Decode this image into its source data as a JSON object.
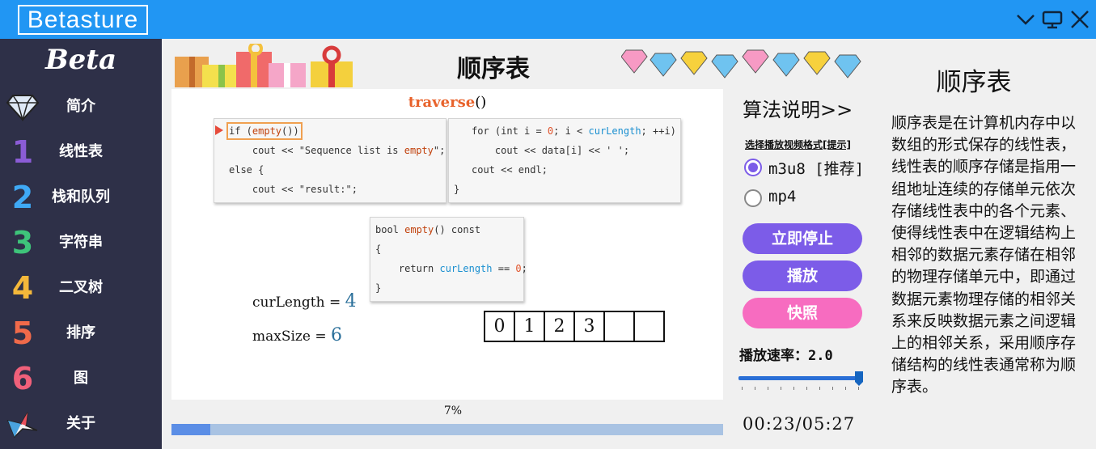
{
  "app": {
    "logo": "Betasture"
  },
  "window_controls": [
    "chevron-down-icon",
    "monitor-icon",
    "close-icon"
  ],
  "sidebar": {
    "brand": "Beta",
    "items": [
      {
        "icon": "diamond-icon",
        "label": "简介"
      },
      {
        "icon": "number-1-icon",
        "label": "线性表"
      },
      {
        "icon": "number-2-icon",
        "label": "栈和队列"
      },
      {
        "icon": "number-3-icon",
        "label": "字符串"
      },
      {
        "icon": "number-4-icon",
        "label": "二叉树"
      },
      {
        "icon": "number-5-icon",
        "label": "排序"
      },
      {
        "icon": "number-6-icon",
        "label": "图"
      },
      {
        "icon": "origami-bird-icon",
        "label": "关于"
      }
    ]
  },
  "header": {
    "title": "顺序表",
    "left_art": "gift-boxes-illustration",
    "right_art": "diamonds-illustration"
  },
  "visual": {
    "function_name": "traverse",
    "function_parens": "()",
    "code_blocks": {
      "main_left": [
        "if (empty())",
        "    cout << \"Sequence list is empty\";",
        "else {",
        "    cout << \"result:\";"
      ],
      "main_right": [
        "for (int i = 0; i < curLength; ++i)",
        "    cout << data[i] << ' ';",
        "cout << endl;",
        "}"
      ],
      "empty_fn": [
        "bool empty() const",
        "{",
        "    return curLength == 0;",
        "}"
      ]
    },
    "variables": [
      {
        "name": "curLength = ",
        "value": "4"
      },
      {
        "name": "maxSize = ",
        "value": "6"
      }
    ],
    "array_cells": [
      "0",
      "1",
      "2",
      "3",
      "",
      ""
    ]
  },
  "progress": {
    "label": "7%",
    "value": 0.07
  },
  "controls": {
    "algo_title": "算法说明>>",
    "format_caption": "选择播放视频格式[提示]",
    "format_options": [
      {
        "label": "m3u8 [推荐]",
        "selected": true
      },
      {
        "label": "mp4",
        "selected": false
      }
    ],
    "buttons": {
      "stop": "立即停止",
      "play": "播放",
      "snapshot": "快照"
    },
    "speed_label": "播放速率：2.0",
    "speed_value": 1.0,
    "time": "00:23/05:27"
  },
  "description": {
    "title": "顺序表",
    "body": "顺序表是在计算机内存中以数组的形式保存的线性表，线性表的顺序存储是指用一组地址连续的存储单元依次存储线性表中的各个元素、使得线性表中在逻辑结构上相邻的数据元素存储在相邻的物理存储单元中，即通过数据元素物理存储的相邻关系来反映数据元素之间逻辑上的相邻关系，采用顺序存储结构的线性表通常称为顺序表。"
  },
  "colors": {
    "titlebar": "#2196f3",
    "sidebar": "#2e3048",
    "accent_purple": "#7c5ce8",
    "accent_pink": "#f76cc0",
    "progress_fill": "#5b8ee6",
    "progress_track": "#a9c3e3",
    "function_name": "#e8622b"
  }
}
